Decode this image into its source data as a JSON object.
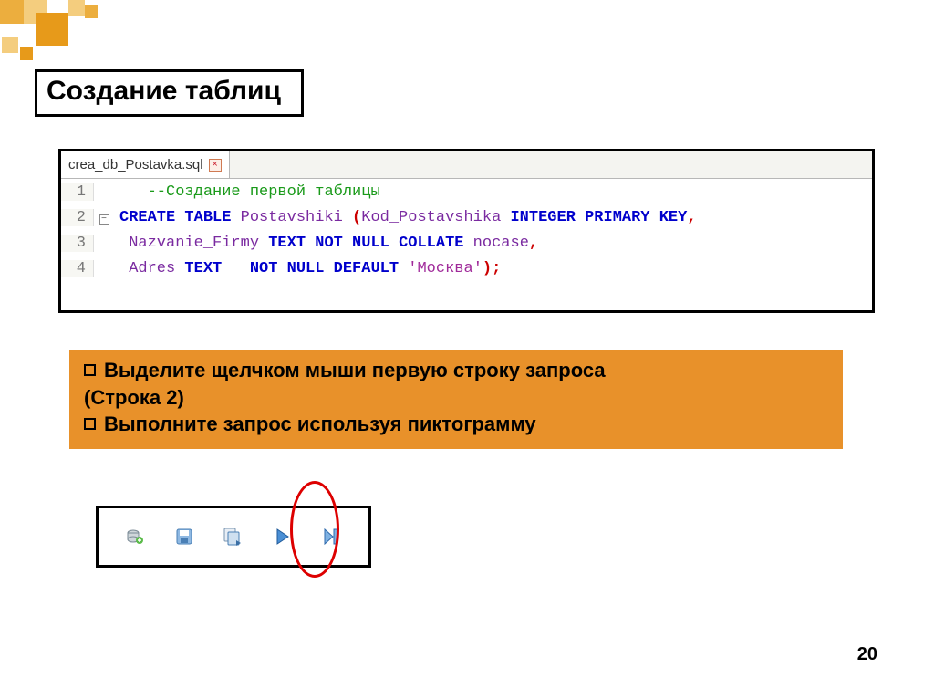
{
  "title": "Создание таблиц",
  "editor": {
    "tab_filename": "crea_db_Postavka.sql",
    "lines": {
      "l1_num": "1",
      "l1_comment": "--Создание первой таблицы",
      "l2_num": "2",
      "l2_kw1": "CREATE TABLE",
      "l2_id1": " Postavshiki ",
      "l2_p1": "(",
      "l2_id2": "Kod_Postavshika",
      "l2_kw2": " INTEGER PRIMARY KEY",
      "l2_p2": ",",
      "l3_num": "3",
      "l3_id1": "Nazvanie_Firmy ",
      "l3_kw1": "TEXT ",
      "l3_kw2": "NOT NULL COLLATE",
      "l3_id2": " nocase",
      "l3_p1": ",",
      "l4_num": "4",
      "l4_id1": "Adres ",
      "l4_kw1": "TEXT   ",
      "l4_kw2": "NOT NULL DEFAULT ",
      "l4_str": "'Москва'",
      "l4_p1": ");"
    }
  },
  "instructions": {
    "b1a": "Выделите щелчком мыши первую строку запроса",
    "b1b": "(Строка 2)",
    "b2": "Выполните запрос используя пиктограмму"
  },
  "page_number": "20"
}
